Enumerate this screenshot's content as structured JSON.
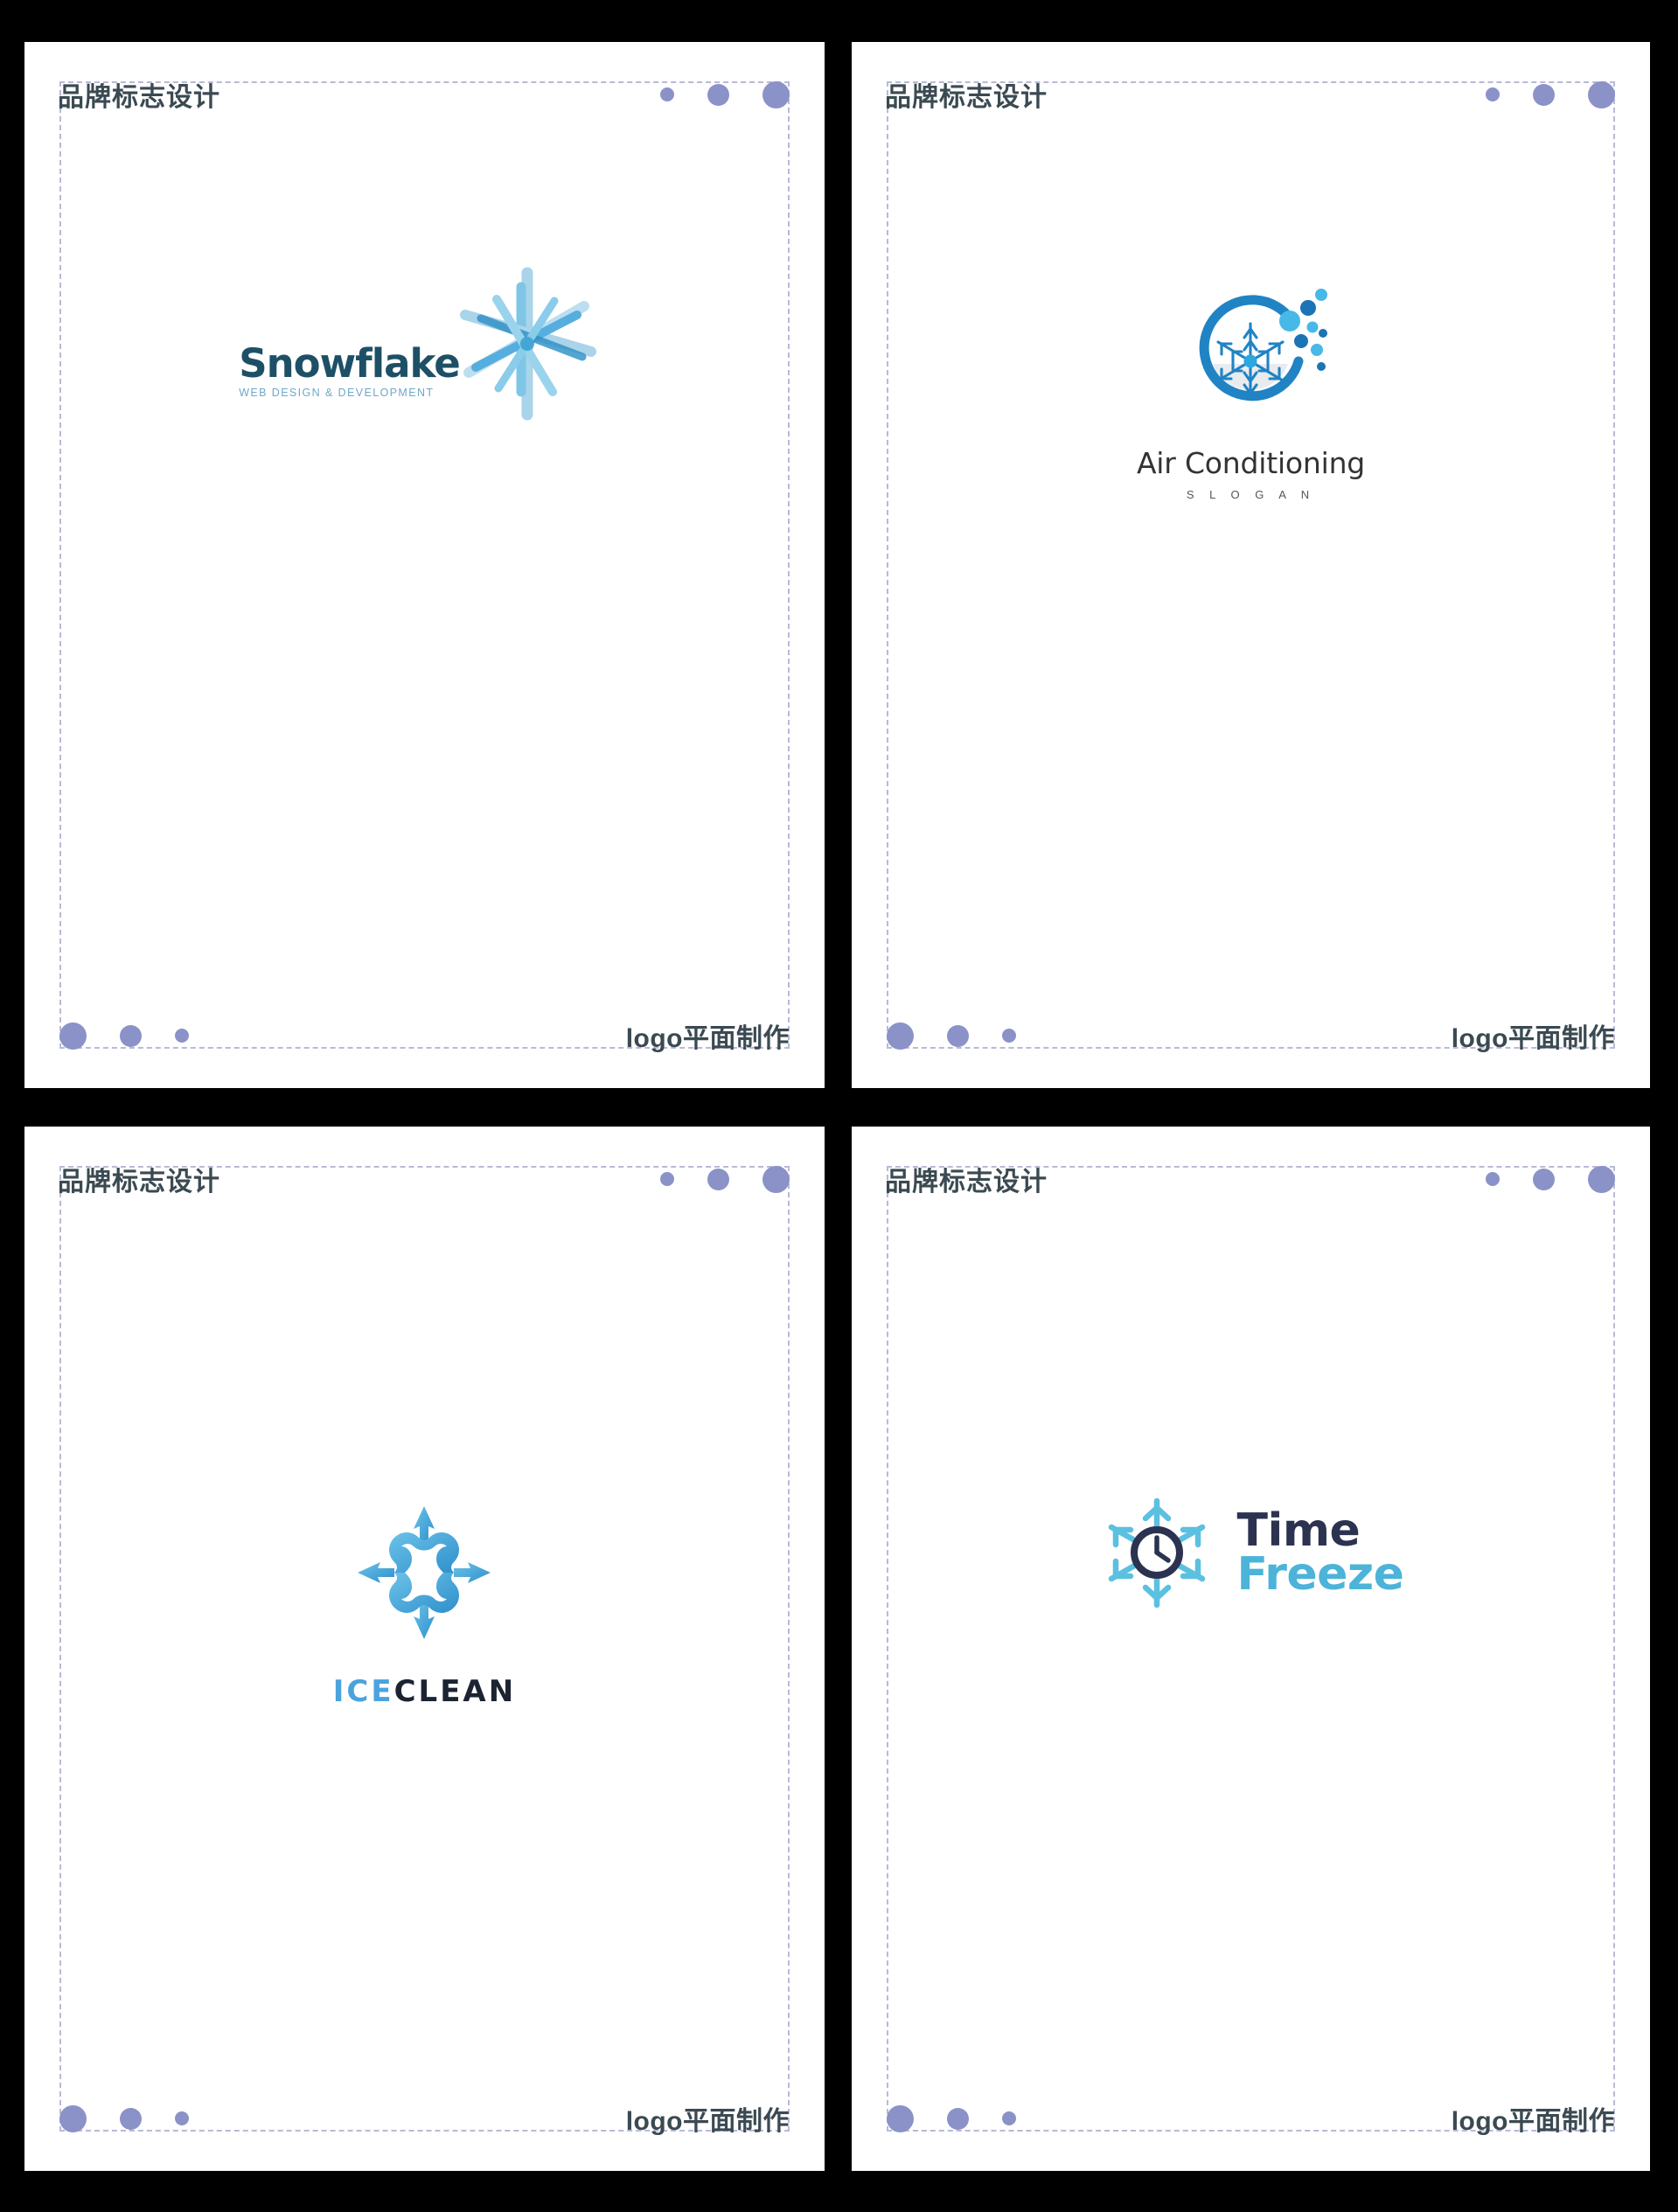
{
  "palette": {
    "page_background": "#000000",
    "card_background": "#ffffff",
    "dashed_border": "#b9b9d8",
    "dot_color": "#8b92c8",
    "heading_color": "#3b4a52",
    "snowflake_name": "#1d5066",
    "snowflake_sub": "#6fa8c8",
    "snowflake_mark_light": "#a9d4ea",
    "snowflake_mark_mid": "#65b9e0",
    "snowflake_mark_dark": "#2e90c6",
    "ac_ring": "#2083c4",
    "ac_flake": "#2083c4",
    "ac_dot_light": "#46b9e8",
    "ac_dot_dark": "#1b74b5",
    "ac_name": "#333333",
    "ac_slogan": "#555555",
    "ice_blue": "#4ba3dd",
    "ice_dark": "#1b2430",
    "ice_mark_light": "#6cc3e8",
    "ice_mark_dark": "#2f8fcc",
    "time_dark": "#2b3350",
    "time_blue": "#4cb3d9"
  },
  "cards": [
    {
      "id": "card-snowflake",
      "header": {
        "title": "品牌标志设计",
        "dots": [
          "small",
          "medium",
          "large"
        ]
      },
      "footer": {
        "label": "logo平面制作",
        "dots": [
          "large",
          "medium",
          "small"
        ]
      },
      "logo": {
        "kind": "snowflake-web-design",
        "name": "Snowflake",
        "subtitle": "WEB DESIGN & DEVELOPMENT",
        "icon_name": "snowflake-star-icon"
      }
    },
    {
      "id": "card-air-conditioning",
      "header": {
        "title": "品牌标志设计",
        "dots": [
          "small",
          "medium",
          "large"
        ]
      },
      "footer": {
        "label": "logo平面制作",
        "dots": [
          "large",
          "medium",
          "small"
        ]
      },
      "logo": {
        "kind": "air-conditioning",
        "name": "Air Conditioning",
        "subtitle": "S L O G A N",
        "icon_name": "ring-snowflake-bubbles-icon"
      }
    },
    {
      "id": "card-ice-clean",
      "header": {
        "title": "品牌标志设计",
        "dots": [
          "small",
          "medium",
          "large"
        ]
      },
      "footer": {
        "label": "logo平面制作",
        "dots": [
          "large",
          "medium",
          "small"
        ]
      },
      "logo": {
        "kind": "ice-clean",
        "name_part_1": "ICE",
        "name_part_2": "CLEAN",
        "icon_name": "ornate-snowflake-icon"
      }
    },
    {
      "id": "card-time-freeze",
      "header": {
        "title": "品牌标志设计",
        "dots": [
          "small",
          "medium",
          "large"
        ]
      },
      "footer": {
        "label": "logo平面制作",
        "dots": [
          "large",
          "medium",
          "small"
        ]
      },
      "logo": {
        "kind": "time-freeze",
        "name_line_1": "Time",
        "name_line_2": "Freeze",
        "icon_name": "snowflake-clock-icon"
      }
    }
  ]
}
